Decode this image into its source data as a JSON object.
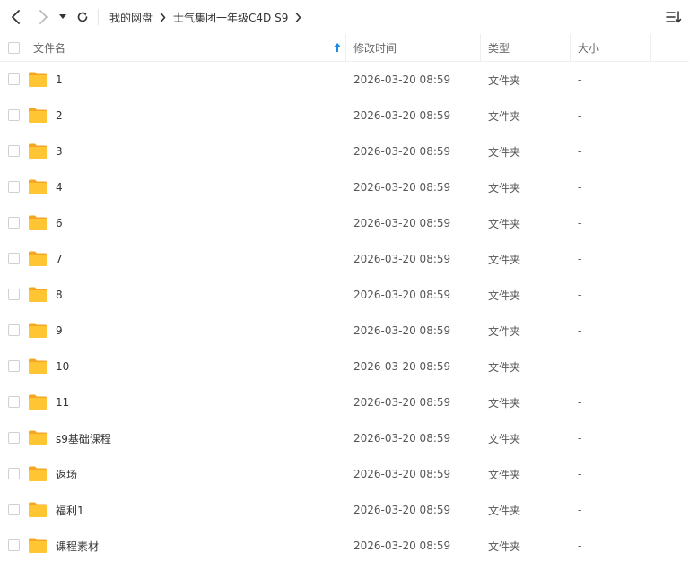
{
  "breadcrumb": [
    "我的网盘",
    "士气集团一年级C4D S9"
  ],
  "columns": {
    "name": "文件名",
    "mtime": "修改时间",
    "type": "类型",
    "size": "大小"
  },
  "rows": [
    {
      "name": "1",
      "mtime": "2026-03-20 08:59",
      "type": "文件夹",
      "size": "-"
    },
    {
      "name": "2",
      "mtime": "2026-03-20 08:59",
      "type": "文件夹",
      "size": "-"
    },
    {
      "name": "3",
      "mtime": "2026-03-20 08:59",
      "type": "文件夹",
      "size": "-"
    },
    {
      "name": "4",
      "mtime": "2026-03-20 08:59",
      "type": "文件夹",
      "size": "-"
    },
    {
      "name": "6",
      "mtime": "2026-03-20 08:59",
      "type": "文件夹",
      "size": "-"
    },
    {
      "name": "7",
      "mtime": "2026-03-20 08:59",
      "type": "文件夹",
      "size": "-"
    },
    {
      "name": "8",
      "mtime": "2026-03-20 08:59",
      "type": "文件夹",
      "size": "-"
    },
    {
      "name": "9",
      "mtime": "2026-03-20 08:59",
      "type": "文件夹",
      "size": "-"
    },
    {
      "name": "10",
      "mtime": "2026-03-20 08:59",
      "type": "文件夹",
      "size": "-"
    },
    {
      "name": "11",
      "mtime": "2026-03-20 08:59",
      "type": "文件夹",
      "size": "-"
    },
    {
      "name": "s9基础课程",
      "mtime": "2026-03-20 08:59",
      "type": "文件夹",
      "size": "-"
    },
    {
      "name": "返场",
      "mtime": "2026-03-20 08:59",
      "type": "文件夹",
      "size": "-"
    },
    {
      "name": "福利1",
      "mtime": "2026-03-20 08:59",
      "type": "文件夹",
      "size": "-"
    },
    {
      "name": "课程素材",
      "mtime": "2026-03-20 08:59",
      "type": "文件夹",
      "size": "-"
    }
  ],
  "icons": {
    "back": "chevron-left-icon",
    "forward": "chevron-right-icon",
    "history": "caret-down-icon",
    "refresh": "refresh-icon",
    "breadcrumb_separator": "chevron-right-icon",
    "sort_menu": "sort-list-icon",
    "sort_indicator": "arrow-up-icon",
    "row_icon": "folder-icon"
  },
  "colors": {
    "folder": "#FFC533",
    "folder_back": "#F5A623",
    "sort_arrow": "#1E88E5",
    "text": "#333333",
    "muted": "#666666"
  }
}
